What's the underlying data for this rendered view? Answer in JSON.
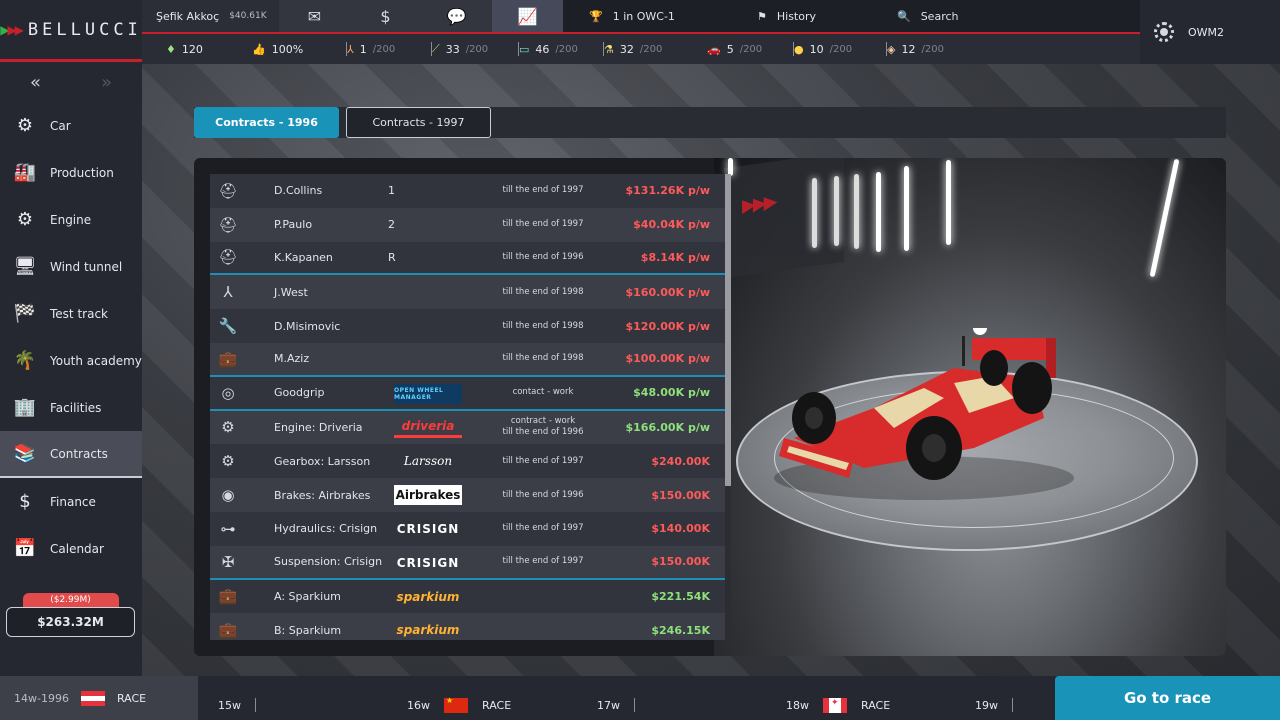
{
  "brand": {
    "name": "BELLUCCI"
  },
  "user": {
    "name": "Şefik Akkoç",
    "money": "$40.61K"
  },
  "topnav": {
    "icons": [
      "mail-icon",
      "money-icon",
      "chat-icon",
      "chart-icon"
    ],
    "standing": "1 in OWC-1",
    "history": "History",
    "search": "Search"
  },
  "stats": [
    {
      "icon": "diamond-icon",
      "value": "120",
      "max": ""
    },
    {
      "icon": "thumbs-up-icon",
      "value": "100%",
      "max": ""
    },
    {
      "icon": "compass-icon",
      "value": "1",
      "max": "/200"
    },
    {
      "icon": "wrench-icon",
      "value": "33",
      "max": "/200"
    },
    {
      "icon": "chassis-icon",
      "value": "46",
      "max": "/200"
    },
    {
      "icon": "flask-icon",
      "value": "32",
      "max": "/200"
    },
    {
      "icon": "car-icon",
      "value": "5",
      "max": "/200"
    },
    {
      "icon": "coin-icon",
      "value": "10",
      "max": "/200"
    },
    {
      "icon": "box-icon",
      "value": "12",
      "max": "/200"
    }
  ],
  "server": {
    "name": "OWM2"
  },
  "sidebar": {
    "items": [
      {
        "label": "Car",
        "icon": "car-engine-icon"
      },
      {
        "label": "Production",
        "icon": "factory-icon"
      },
      {
        "label": "Engine",
        "icon": "engine-icon"
      },
      {
        "label": "Wind tunnel",
        "icon": "wind-tunnel-icon"
      },
      {
        "label": "Test track",
        "icon": "test-track-icon"
      },
      {
        "label": "Youth academy",
        "icon": "palm-icon"
      },
      {
        "label": "Facilities",
        "icon": "building-icon"
      },
      {
        "label": "Contracts",
        "icon": "contracts-icon"
      },
      {
        "label": "Finance",
        "icon": "dollar-coin-icon"
      },
      {
        "label": "Calendar",
        "icon": "calendar-icon"
      }
    ],
    "balance_change": "($2.99M)",
    "balance": "$263.32M"
  },
  "tabs": [
    {
      "label": "Contracts - 1996",
      "active": true
    },
    {
      "label": "Contracts - 1997",
      "active": false
    }
  ],
  "contracts": [
    {
      "icon": "helmet-icon",
      "name": "D.Collins",
      "slot": "1",
      "logo": "",
      "term": "till the end of 1997",
      "cost": "$131.26K p/w",
      "color": "red"
    },
    {
      "icon": "helmet-icon",
      "name": "P.Paulo",
      "slot": "2",
      "logo": "",
      "term": "till the end of 1997",
      "cost": "$40.04K p/w",
      "color": "red"
    },
    {
      "icon": "helmet-icon",
      "name": "K.Kapanen",
      "slot": "R",
      "logo": "",
      "term": "till the end of 1996",
      "cost": "$8.14K p/w",
      "color": "red"
    },
    {
      "icon": "compass-icon",
      "name": "J.West",
      "slot": "",
      "logo": "",
      "term": "till the end of 1998",
      "cost": "$160.00K p/w",
      "color": "red"
    },
    {
      "icon": "wrench-icon",
      "name": "D.Misimovic",
      "slot": "",
      "logo": "",
      "term": "till the end of 1998",
      "cost": "$120.00K p/w",
      "color": "red"
    },
    {
      "icon": "briefcase-icon",
      "name": "M.Aziz",
      "slot": "",
      "logo": "",
      "term": "till the end of 1998",
      "cost": "$100.00K p/w",
      "color": "red"
    },
    {
      "icon": "tyre-icon",
      "name": "Goodgrip",
      "slot": "",
      "logo": "OPEN WHEEL MANAGER",
      "term": "contact - work",
      "cost": "$48.00K p/w",
      "color": "green"
    },
    {
      "icon": "engine-icon",
      "name": "Engine: Driveria",
      "slot": "",
      "logo": "driveria",
      "term": "contract - work\ntill the end of 1996",
      "cost": "$166.00K p/w",
      "color": "green"
    },
    {
      "icon": "gearbox-icon",
      "name": "Gearbox: Larsson",
      "slot": "",
      "logo": "Larsson",
      "term": "till the end of 1997",
      "cost": "$240.00K",
      "color": "red"
    },
    {
      "icon": "brake-icon",
      "name": "Brakes: Airbrakes",
      "slot": "",
      "logo": "Airbrakes",
      "term": "till the end of 1996",
      "cost": "$150.00K",
      "color": "red"
    },
    {
      "icon": "hydraulics-icon",
      "name": "Hydraulics: Crisign",
      "slot": "",
      "logo": "CRISIGN",
      "term": "till the end of 1997",
      "cost": "$140.00K",
      "color": "red"
    },
    {
      "icon": "suspension-icon",
      "name": "Suspension: Crisign",
      "slot": "",
      "logo": "CRISIGN",
      "term": "till the end of 1997",
      "cost": "$150.00K",
      "color": "red"
    },
    {
      "icon": "briefcase-icon",
      "name": "A: Sparkium",
      "slot": "",
      "logo": "sparkium",
      "term": "",
      "cost": "$221.54K",
      "color": "green"
    },
    {
      "icon": "briefcase-icon",
      "name": "B: Sparkium",
      "slot": "",
      "logo": "sparkium",
      "term": "",
      "cost": "$246.15K",
      "color": "green"
    }
  ],
  "timeline": {
    "current": {
      "week": "14w-1996",
      "flag": "flag-austria-icon",
      "label": "RACE"
    },
    "weeks": [
      {
        "week": "15w",
        "flag": "",
        "label": ""
      },
      {
        "week": "16w",
        "flag": "flag-china-icon",
        "label": "RACE"
      },
      {
        "week": "17w",
        "flag": "",
        "label": ""
      },
      {
        "week": "18w",
        "flag": "flag-canada-icon",
        "label": "RACE"
      },
      {
        "week": "19w",
        "flag": "",
        "label": ""
      }
    ]
  },
  "action": {
    "go_to_race": "Go to race"
  },
  "colors": {
    "accent": "#1a93b9",
    "brand_red": "#c8202b",
    "cost_red": "#ff5a5a",
    "cost_green": "#8ee07d"
  }
}
